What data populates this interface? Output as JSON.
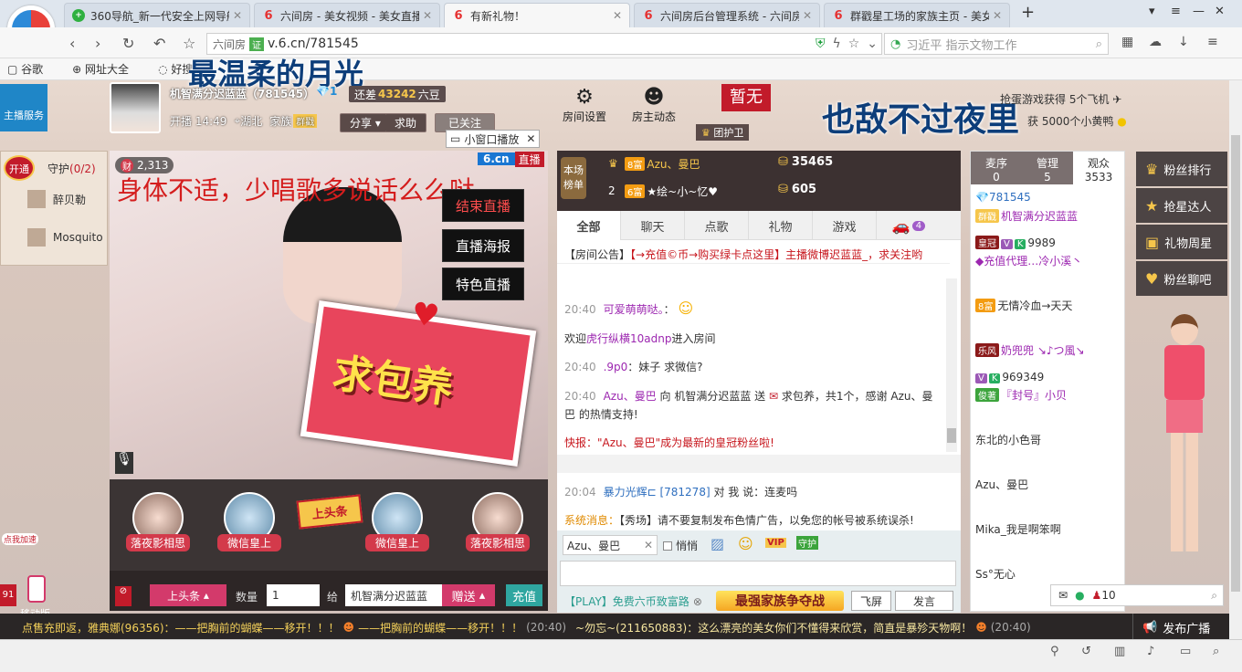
{
  "browser": {
    "tabs": [
      {
        "icon": "360",
        "title": "360导航_新一代安全上网导航"
      },
      {
        "icon": "6",
        "title": "六间房 - 美女视频 - 美女直播"
      },
      {
        "icon": "6",
        "title": "有新礼物！"
      },
      {
        "icon": "6",
        "title": "六间房后台管理系统 - 六间房"
      },
      {
        "icon": "6",
        "title": "群戳星工场的家族主页 - 美女"
      }
    ],
    "url_prefix": "六间房",
    "url_badge": "证",
    "url": "v.6.cn/781545",
    "search_placeholder": "习近平 指示文物工作",
    "bookmarks": [
      "谷歌",
      "网址大全",
      "好搜"
    ]
  },
  "overlay": {
    "top_left": "最温柔的月光",
    "top_right": "也敌不过夜里"
  },
  "side_service": "主播服务",
  "anchor": {
    "name": "机智满分迟蓝蓝（781545）",
    "level_badge": "1",
    "gap_label": "还差",
    "gap_value": "43242",
    "gap_unit": "六豆",
    "start_label": "开播",
    "start_time": "14:49",
    "location": "湖北",
    "family_label": "家族",
    "family_badge": "群戳",
    "share": "分享",
    "help": "求助",
    "followed": "已关注",
    "room_settings": "房间设置",
    "owner_dynamic": "房主动态",
    "guard_none": "暂无",
    "guard_label": "团护卫",
    "announce": "恭喜",
    "announce_text": "抢蛋游戏获得 5个飞机",
    "announce_text2": "获 5000个小黄鸭"
  },
  "left": {
    "open_btn": "开通",
    "guard_label": "守护",
    "guard_count": "(0/2)",
    "members": [
      {
        "name": "醉贝勒"
      },
      {
        "name": "Mosquito"
      }
    ]
  },
  "video": {
    "hot_icon": "财",
    "hot_count": "2,313",
    "brand": "6.cn",
    "live": "直播",
    "mini_play": "小窗口播放",
    "subtitle": "身体不适，少唱歌多说话么么哒",
    "buttons": [
      "结束直播",
      "直播海报",
      "特色直播"
    ],
    "envelope_text": "求包养"
  },
  "gifts": [
    {
      "label": "落夜影相思"
    },
    {
      "label": "微信皇上"
    },
    {
      "label": "上头条"
    },
    {
      "label": "微信皇上"
    },
    {
      "label": "落夜影相思"
    }
  ],
  "sendbar": {
    "gift_select": "上头条",
    "qty_label": "数量",
    "qty_value": "1",
    "to_label": "给",
    "to_value": "机智满分迟蓝蓝",
    "send": "赠送",
    "recharge": "充值",
    "mobile": "移动版",
    "speed": "点我加速",
    "speed_num": "91"
  },
  "rank": {
    "title_top": "本场",
    "title_bottom": "榜单",
    "rows": [
      {
        "rank": "1",
        "level": "8富",
        "name": "Azu、曼巴",
        "value": "35465"
      },
      {
        "rank": "2",
        "level": "6富",
        "name": "★绘~小~忆♥",
        "value": "605"
      }
    ]
  },
  "chat": {
    "tabs": [
      "全部",
      "聊天",
      "点歌",
      "礼物",
      "游戏"
    ],
    "car_count": "4",
    "notice_label": "【房间公告】",
    "notice_text": "【→充值©币→购买绿卡点这里】主播微博迟蓝蓝_，求关注哟",
    "messages": [
      {
        "time": "20:40",
        "user": "可爱萌萌哒。",
        "text": "："
      },
      {
        "time": "",
        "user": "虎行纵横10adnp",
        "text": "进入房间",
        "prefix": "欢迎"
      },
      {
        "time": "20:40",
        "user": ".9p0",
        "text": "：妹子 求微信?"
      },
      {
        "time": "20:40",
        "user": "Azu、曼巴",
        "text": "向 机智满分迟蓝蓝 送",
        "gift": "求包养，共1个，感谢 Azu、曼巴 的热情支持!"
      },
      {
        "time": "",
        "user": "",
        "text": "快报：\"Azu、曼巴\"成为最新的皇冠粉丝啦!"
      },
      {
        "time": "20:04",
        "user": "暴力光辉⊏ [781278]",
        "text": "对 我 说：连麦吗"
      },
      {
        "time": "",
        "user": "系统消息：",
        "text": "【秀场】请不要复制发布色情广告，以免您的帐号被系统误杀!"
      }
    ],
    "reply_to": "Azu、曼巴",
    "whisper": "悄悄",
    "play_text": "【PLAY】免费六币致富路",
    "battle": "最强家族争夺战",
    "fly": "飞屏",
    "speak": "发言"
  },
  "viewers": {
    "tabs": [
      {
        "label": "麦序",
        "count": "0"
      },
      {
        "label": "管理",
        "count": "5"
      },
      {
        "label": "观众",
        "count": "3533"
      }
    ],
    "list": [
      {
        "badge": "1",
        "name": "781545"
      },
      {
        "badge": "群戳",
        "name": "机智满分迟蓝蓝"
      },
      {
        "badge": "皇冠",
        "name": "9989"
      },
      {
        "badge": "",
        "name": "◆充值代理…冷小溪丶"
      },
      {
        "badge": "8富",
        "name": "无情冷血→天天"
      },
      {
        "badge": "乐风",
        "name": "奶兜兜 ↘♪つ風↘"
      },
      {
        "badge": "",
        "name": "969349"
      },
      {
        "badge": "俊著",
        "name": "『封号』小贝"
      },
      {
        "badge": "9富",
        "name": "东北的小色哥"
      },
      {
        "badge": "8富",
        "name": "Azu、曼巴"
      },
      {
        "badge": "6富",
        "name": "Mika_我是啊笨啊"
      },
      {
        "badge": "8富",
        "name": "Ss°无心"
      }
    ],
    "follow_count": "10"
  },
  "rightnav": [
    "粉丝排行",
    "抢星达人",
    "礼物周星",
    "粉丝聊吧"
  ],
  "marquee": {
    "text1": "点售充即返，雅典娜(96356)：——把胸前的蝴蝶——移开！！！",
    "text2": "——把胸前的蝴蝶——移开！！！",
    "time1": "(20:40)",
    "text3": "~勿忘~(211650883)：这么漂亮的美女你们不懂得来欣赏，简直是暴殄天物啊！",
    "time2": "(20:40)",
    "broadcast": "发布广播"
  }
}
